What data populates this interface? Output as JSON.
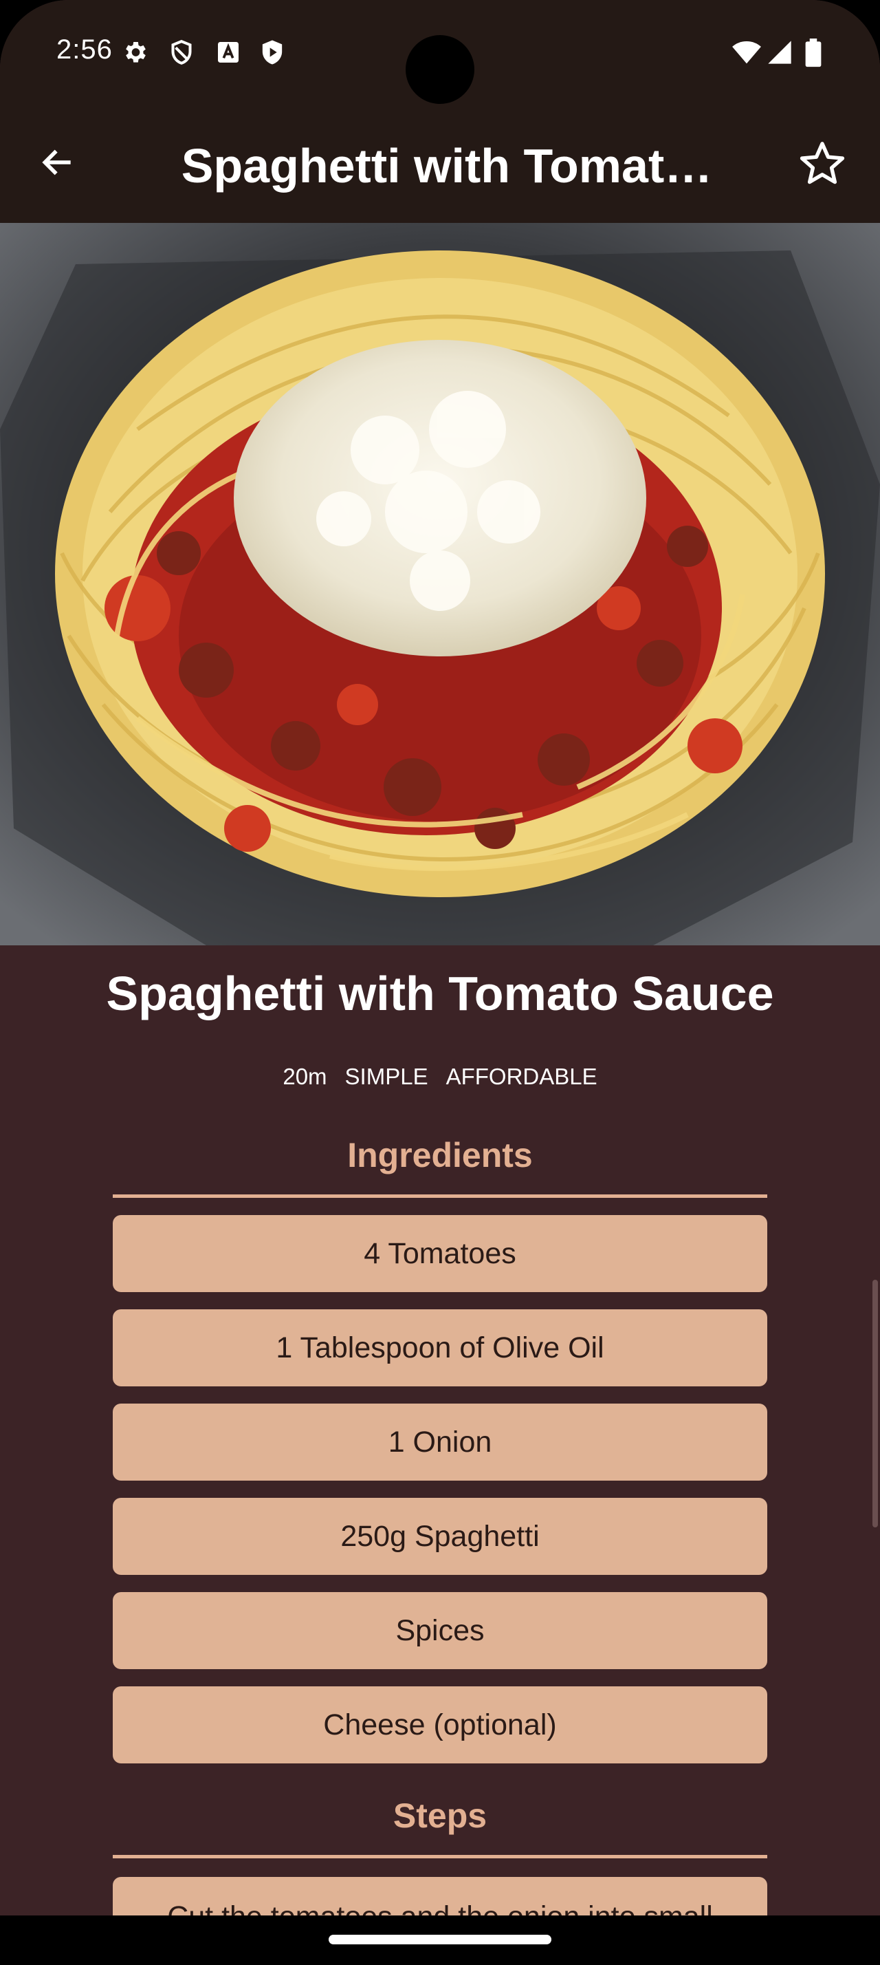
{
  "status_bar": {
    "time": "2:56",
    "left_icons": [
      "settings-icon",
      "shield-icon",
      "a-letter-icon",
      "play-shield-icon"
    ],
    "right_icons": [
      "wifi-icon",
      "signal-icon",
      "battery-icon"
    ]
  },
  "app_bar": {
    "title": "Spaghetti with Tomat…",
    "back_icon": "arrow-left-icon",
    "favorite_icon": "star-outline-icon"
  },
  "recipe": {
    "title": "Spaghetti with Tomato Sauce",
    "duration": "20m",
    "complexity": "SIMPLE",
    "affordability": "AFFORDABLE"
  },
  "ingredients": {
    "heading": "Ingredients",
    "items": [
      "4 Tomatoes",
      "1 Tablespoon of Olive Oil",
      "1 Onion",
      "250g Spaghetti",
      "Spices",
      "Cheese (optional)"
    ]
  },
  "steps": {
    "heading": "Steps",
    "items": [
      "Cut the tomatoes and the onion into small"
    ]
  },
  "colors": {
    "background": "#3c2326",
    "app_bar": "#241915",
    "accent": "#e3b092",
    "card": "#e0b395",
    "card_text": "#2a1a16"
  }
}
